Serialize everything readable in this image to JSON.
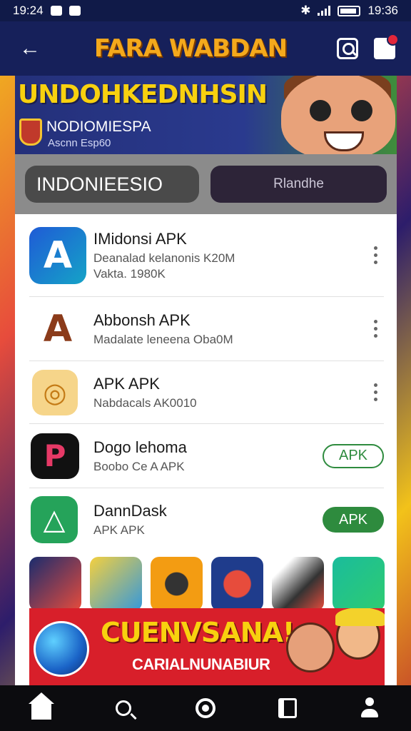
{
  "status_bar": {
    "time_left": "19:24",
    "time_right": "19:36"
  },
  "app_bar": {
    "title": "FARA WABDAN",
    "icons": [
      "back-arrow-icon",
      "search-icon",
      "notification-icon"
    ]
  },
  "banner": {
    "title": "UNDOHKEDNHSIN",
    "subtitle": "NODIOMIESPA",
    "caption": "Ascnn Esp60"
  },
  "tabs": {
    "main_label": "INDONIEESIO",
    "alt_label": "Rlandhe"
  },
  "apps": [
    {
      "name": "IMidonsi APK",
      "desc": "Deanalad kelanonis K20M",
      "meta": "Vakta. 1980K",
      "action": "menu",
      "icon_color": "#1f5bd6"
    },
    {
      "name": "Abbonsh APK",
      "desc": "Madalate leneena Oba0M",
      "meta": "",
      "action": "menu",
      "icon_color": "#8b3b1a"
    },
    {
      "name": "APK APK",
      "desc": "Nabdacals AK0010",
      "meta": "",
      "action": "menu",
      "icon_color": "#f2b544"
    },
    {
      "name": "Dogo lehoma",
      "desc": "Boobo Ce A APK",
      "meta": "",
      "action": "APK",
      "icon_color": "#111111"
    },
    {
      "name": "DannDask",
      "desc": "APK APK",
      "meta": "",
      "action": "APK",
      "icon_color": "#25a35a"
    }
  ],
  "promo": {
    "title": "CUENVSANA!",
    "subtitle": "CARIALNUNABIUR"
  },
  "bottom_nav": [
    "home-icon",
    "search-icon",
    "discover-icon",
    "library-icon",
    "profile-icon"
  ]
}
